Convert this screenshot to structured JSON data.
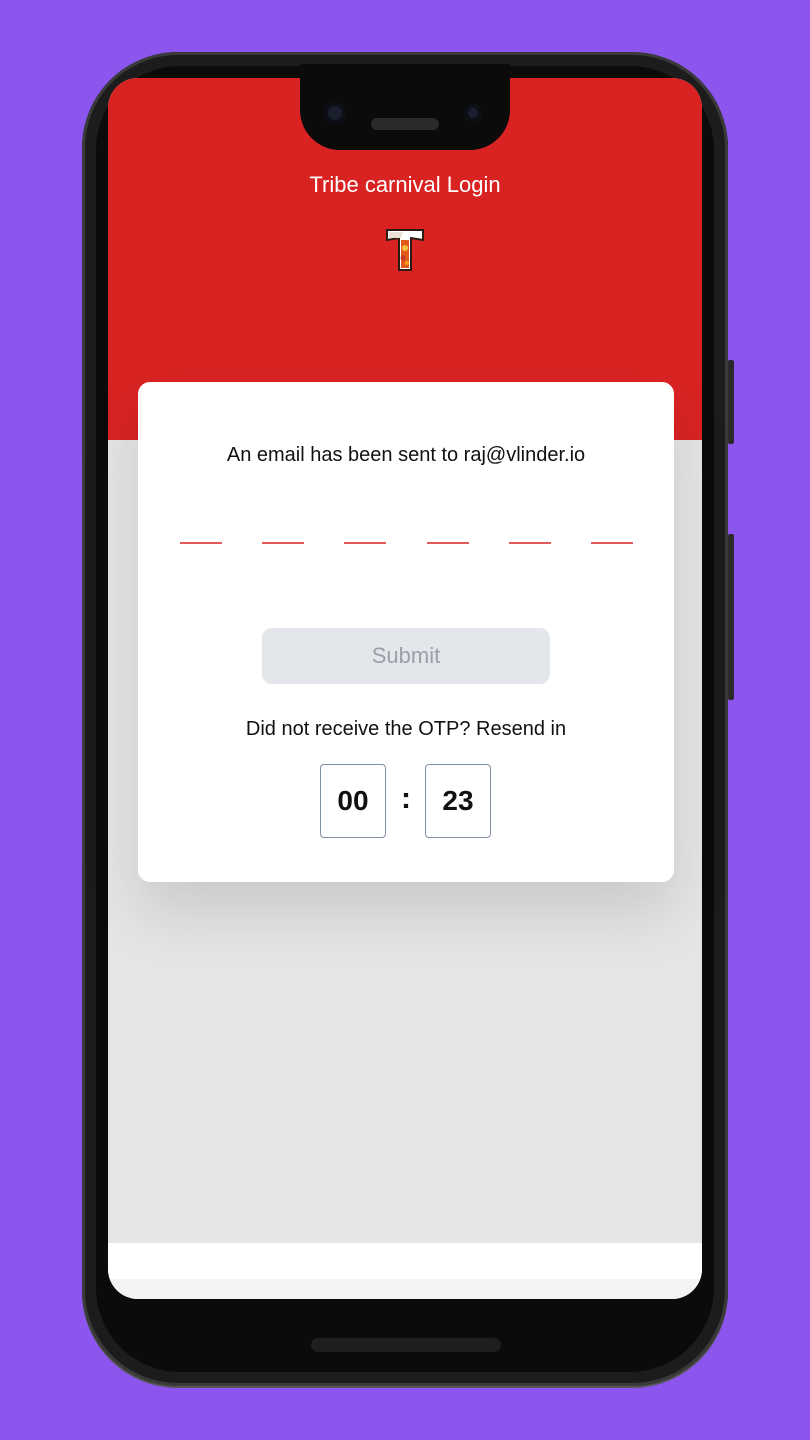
{
  "app": {
    "title": "Tribe carnival Login",
    "logo_icon": "tribe-t-logo-icon"
  },
  "otp": {
    "message": "An email has been sent to raj@vlinder.io",
    "slots": [
      "",
      "",
      "",
      "",
      "",
      ""
    ],
    "slot_color": "#e05a5a"
  },
  "submit": {
    "label": "Submit"
  },
  "resend": {
    "text": "Did not receive the OTP? Resend in",
    "minutes": "00",
    "separator": ":",
    "seconds": "23"
  },
  "colors": {
    "background": "#8c55ee",
    "header": "#d92323",
    "submit_disabled_bg": "#e3e6ea"
  }
}
